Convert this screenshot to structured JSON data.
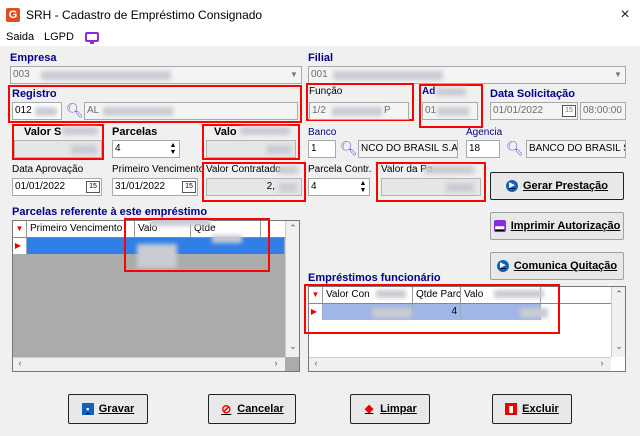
{
  "window": {
    "title": "SRH - Cadastro de Empréstimo Consignado",
    "close": "×",
    "app_icon_letter": "G"
  },
  "menu": {
    "items": [
      "Saida",
      "LGPD"
    ]
  },
  "empresa": {
    "label": "Empresa",
    "value": "003"
  },
  "filial": {
    "label": "Filial",
    "value": "001"
  },
  "registro": {
    "label": "Registro",
    "code": "012",
    "name": "AL"
  },
  "funcao": {
    "label": "Função",
    "value": "1/2",
    "suffix": "P"
  },
  "admissao": {
    "label": "Ad",
    "value": "01"
  },
  "data_solicitacao": {
    "label": "Data Solicitação",
    "date": "01/01/2022",
    "time": "08:00:00"
  },
  "valor_s": {
    "label": "Valor S"
  },
  "parcelas": {
    "label": "Parcelas",
    "value": "4"
  },
  "valor": {
    "label": "Valo"
  },
  "banco": {
    "label": "Banco",
    "code": "1",
    "name": "NCO DO BRASIL S.A."
  },
  "agencia": {
    "label": "Agencia",
    "code": "18",
    "name": "BANCO DO BRASIL S"
  },
  "data_aprovacao": {
    "label": "Data Aprovação",
    "value": "01/01/2022"
  },
  "primeiro_vencimento": {
    "label": "Primeiro Vencimento",
    "value": "31/01/2022"
  },
  "valor_contratado": {
    "label": "Valor Contratado",
    "value": "2,"
  },
  "parcela_contr": {
    "label": "Parcela Contr.",
    "value": "4"
  },
  "valor_parcela": {
    "label": "Valor da Pa"
  },
  "buttons": {
    "gerar": "Gerar Prestação",
    "imprimir": "Imprimir Autorização",
    "comunica": "Comunica Quitação",
    "gravar": "Gravar",
    "cancelar": "Cancelar",
    "limpar": "Limpar",
    "excluir": "Excluir"
  },
  "parcelas_grid": {
    "title": "Parcelas referente à este empréstimo",
    "columns": [
      "Primeiro Vencimento",
      "Valo",
      "Qtde"
    ]
  },
  "emprestimos_grid": {
    "title": "Empréstimos funcionário",
    "columns": [
      "Valor Con",
      "Qtde Parc",
      "Valo"
    ],
    "row_qtde": "4"
  },
  "colors": {
    "accent_red": "#ff0000",
    "label_blue": "#00008b",
    "selection_blue": "#2f7fe6"
  }
}
